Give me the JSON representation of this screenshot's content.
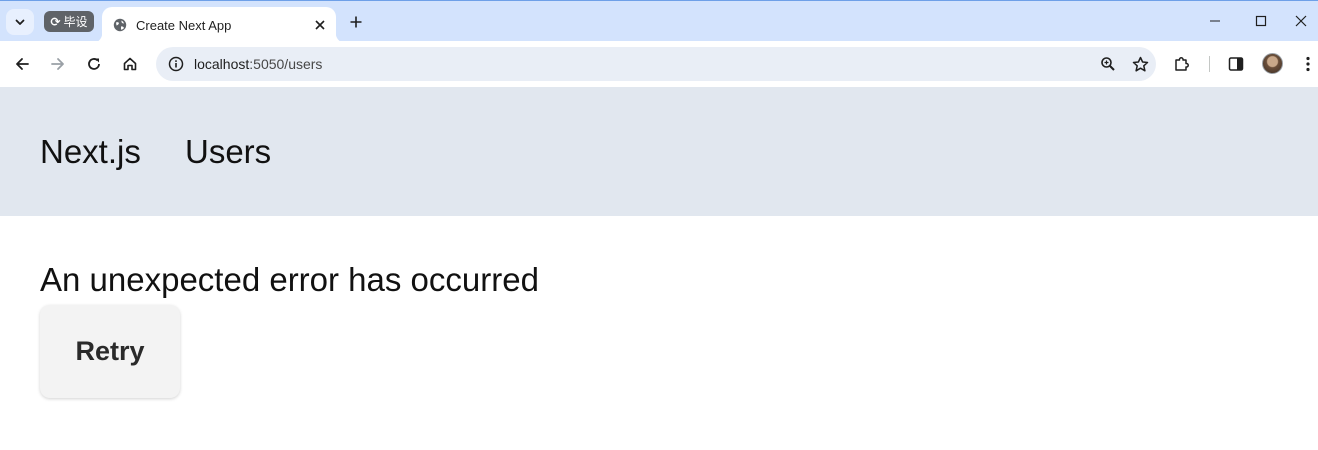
{
  "browser": {
    "tab_group_label": "毕设",
    "tab_title": "Create Next App",
    "url_host": "localhost",
    "url_rest": ":5050/users"
  },
  "nav": {
    "brand": "Next.js",
    "users_link": "Users"
  },
  "main": {
    "error_message": "An unexpected error has occurred",
    "retry_label": "Retry"
  },
  "colors": {
    "tabstrip": "#d3e3fd",
    "nav_background": "#e1e7ef",
    "button_background": "#f3f3f3"
  }
}
